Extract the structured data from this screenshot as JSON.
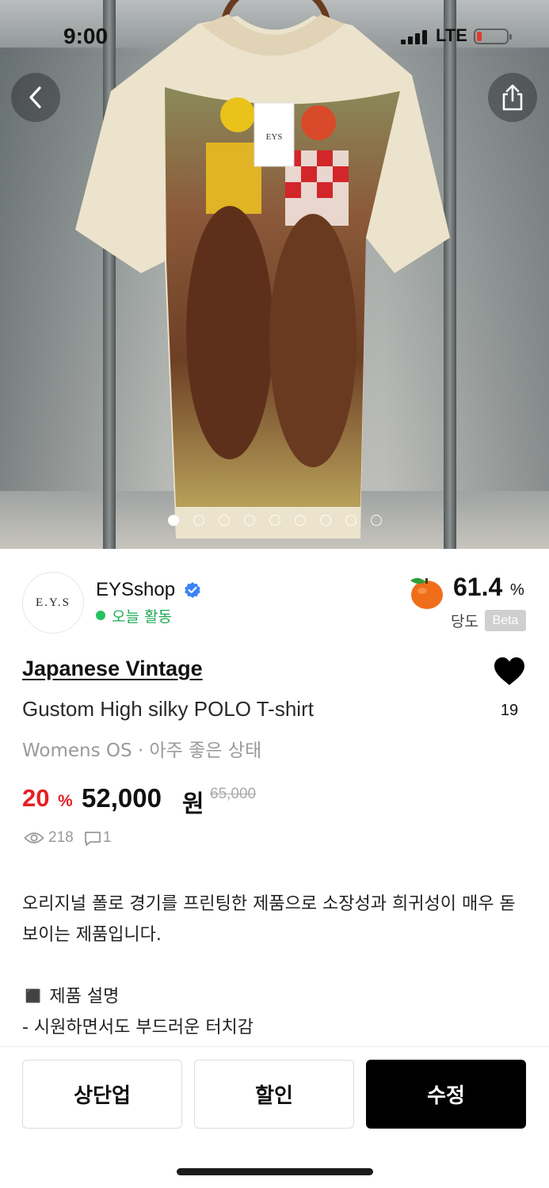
{
  "status_bar": {
    "time": "9:00",
    "network": "LTE"
  },
  "gallery": {
    "total": 9,
    "current": 1,
    "tag_text": "EYS"
  },
  "seller": {
    "avatar_text": "E.Y.S",
    "name": "EYSshop",
    "activity": "오늘 활동",
    "score_value": "61.4",
    "score_unit": "%",
    "score_label": "당도",
    "beta_label": "Beta"
  },
  "product": {
    "brand": "Japanese Vintage",
    "title": "Gustom High silky POLO T-shirt",
    "meta": "Womens OS · 아주 좋은 상태",
    "likes": "19",
    "discount_value": "20",
    "discount_unit": "%",
    "price": "52,000",
    "price_unit": "원",
    "original_price": "65,000",
    "views": "218",
    "comments": "1",
    "description": "오리지널 폴로 경기를 프린팅한 제품으로 소장성과 희귀성이 매우 돋 보이는 제품입니다.\n\n◼️ 제품 설명\n- 시원하면서도 부드러운 터치감\n- 전면 폴로 경기 프린팅"
  },
  "actions": {
    "bump_label": "상단업",
    "discount_label": "할인",
    "edit_label": "수정"
  },
  "colors": {
    "accent": "#e62026",
    "active": "#22c35e",
    "verified": "#3b82f6"
  }
}
